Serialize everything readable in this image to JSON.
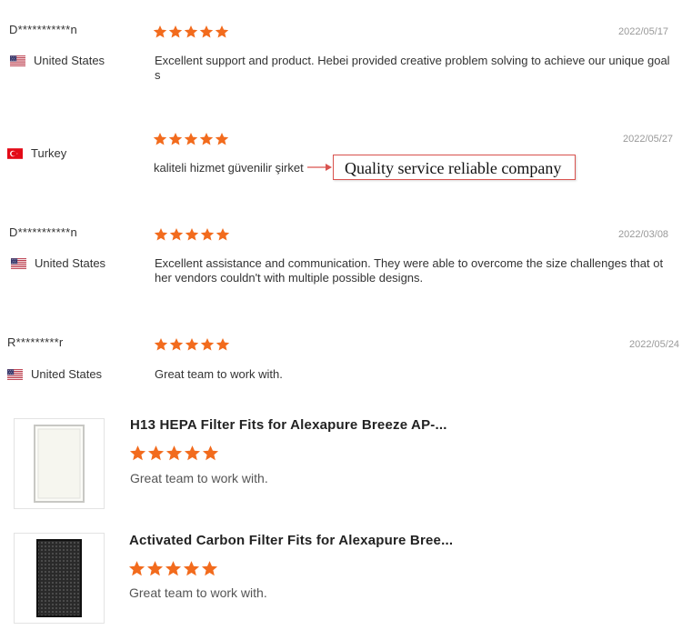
{
  "colors": {
    "star": "#f26b1d",
    "date": "#999999",
    "arrow": "#d9534f"
  },
  "reviews": [
    {
      "name": "D***********n",
      "country": "United States",
      "flag": "us-flag-icon",
      "rating": 5,
      "date": "2022/05/17",
      "text_line1": "Excellent support and product. Hebei provided creative problem solving to achieve our unique goal",
      "text_line2": "s"
    },
    {
      "name": "",
      "country": "Turkey",
      "flag": "turkey-flag-icon",
      "rating": 5,
      "date": "2022/05/27",
      "text_line1": "kaliteli hizmet güvenilir şirket",
      "translation": "Quality service reliable company"
    },
    {
      "name": "D***********n",
      "country": "United States",
      "flag": "us-flag-icon",
      "rating": 5,
      "date": "2022/03/08",
      "text_line1": "Excellent assistance and communication. They were able to overcome the size challenges that ot",
      "text_line2": "her vendors couldn't with multiple possible designs."
    },
    {
      "name": "R*********r",
      "country": "United States",
      "flag": "us-flag-icon",
      "rating": 5,
      "date": "2022/05/24",
      "text_line1": "Great team to work with."
    }
  ],
  "products": [
    {
      "title": "H13 HEPA Filter Fits for Alexapure Breeze AP-...",
      "rating": 5,
      "comment": "Great team to work with.",
      "image_icon": "hepa-filter-image"
    },
    {
      "title": "Activated Carbon Filter Fits for Alexapure Bree...",
      "rating": 5,
      "comment": "Great team to work with.",
      "image_icon": "carbon-filter-image"
    }
  ]
}
